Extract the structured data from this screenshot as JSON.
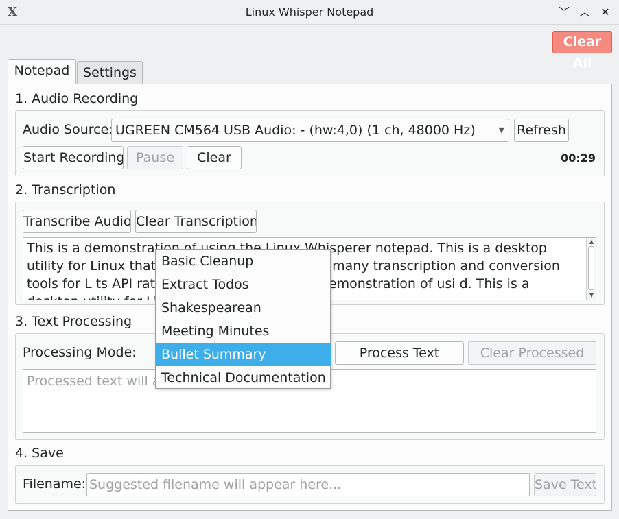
{
  "window": {
    "title": "Linux Whisper Notepad",
    "app_icon": "X",
    "minimize": "﹀",
    "maximize": "︿",
    "close": "✕"
  },
  "toolbar": {
    "clear_all": "Clear All"
  },
  "tabs": [
    {
      "label": "Notepad"
    },
    {
      "label": "Settings"
    }
  ],
  "recording": {
    "title": "1. Audio Recording",
    "source_label": "Audio Source:",
    "source_value": "UGREEN CM564 USB Audio: - (hw:4,0) (1 ch, 48000 Hz)",
    "refresh": "Refresh",
    "start": "Start Recording",
    "pause": "Pause",
    "clear": "Clear",
    "timer": "00:29"
  },
  "transcription": {
    "title": "2. Transcription",
    "transcribe": "Transcribe Audio",
    "clear": "Clear Transcription",
    "text": "This is a demonstration of using the Linux Whisperer notepad. This is a desktop utility for Linux that I created u                                  ere aren't that many transcription and conversion tools for L                                 ts API rather than locally. This is a demonstration of usi                                   d. This is a desktop utility for Linux that"
  },
  "processing": {
    "title": "3. Text Processing",
    "mode_label": "Processing Mode:",
    "process": "Process Text",
    "clear": "Clear Processed",
    "placeholder": "Processed text will ap",
    "options": [
      "Basic Cleanup",
      "Extract Todos",
      "Shakespearean",
      "Meeting Minutes",
      "Bullet Summary",
      "Technical Documentation"
    ],
    "selected_option": "Bullet Summary"
  },
  "save": {
    "title": "4. Save",
    "filename_label": "Filename:",
    "filename_placeholder": "Suggested filename will appear here...",
    "save": "Save Text"
  },
  "colors": {
    "accent": "#3daee9",
    "danger": "#f48a80"
  }
}
